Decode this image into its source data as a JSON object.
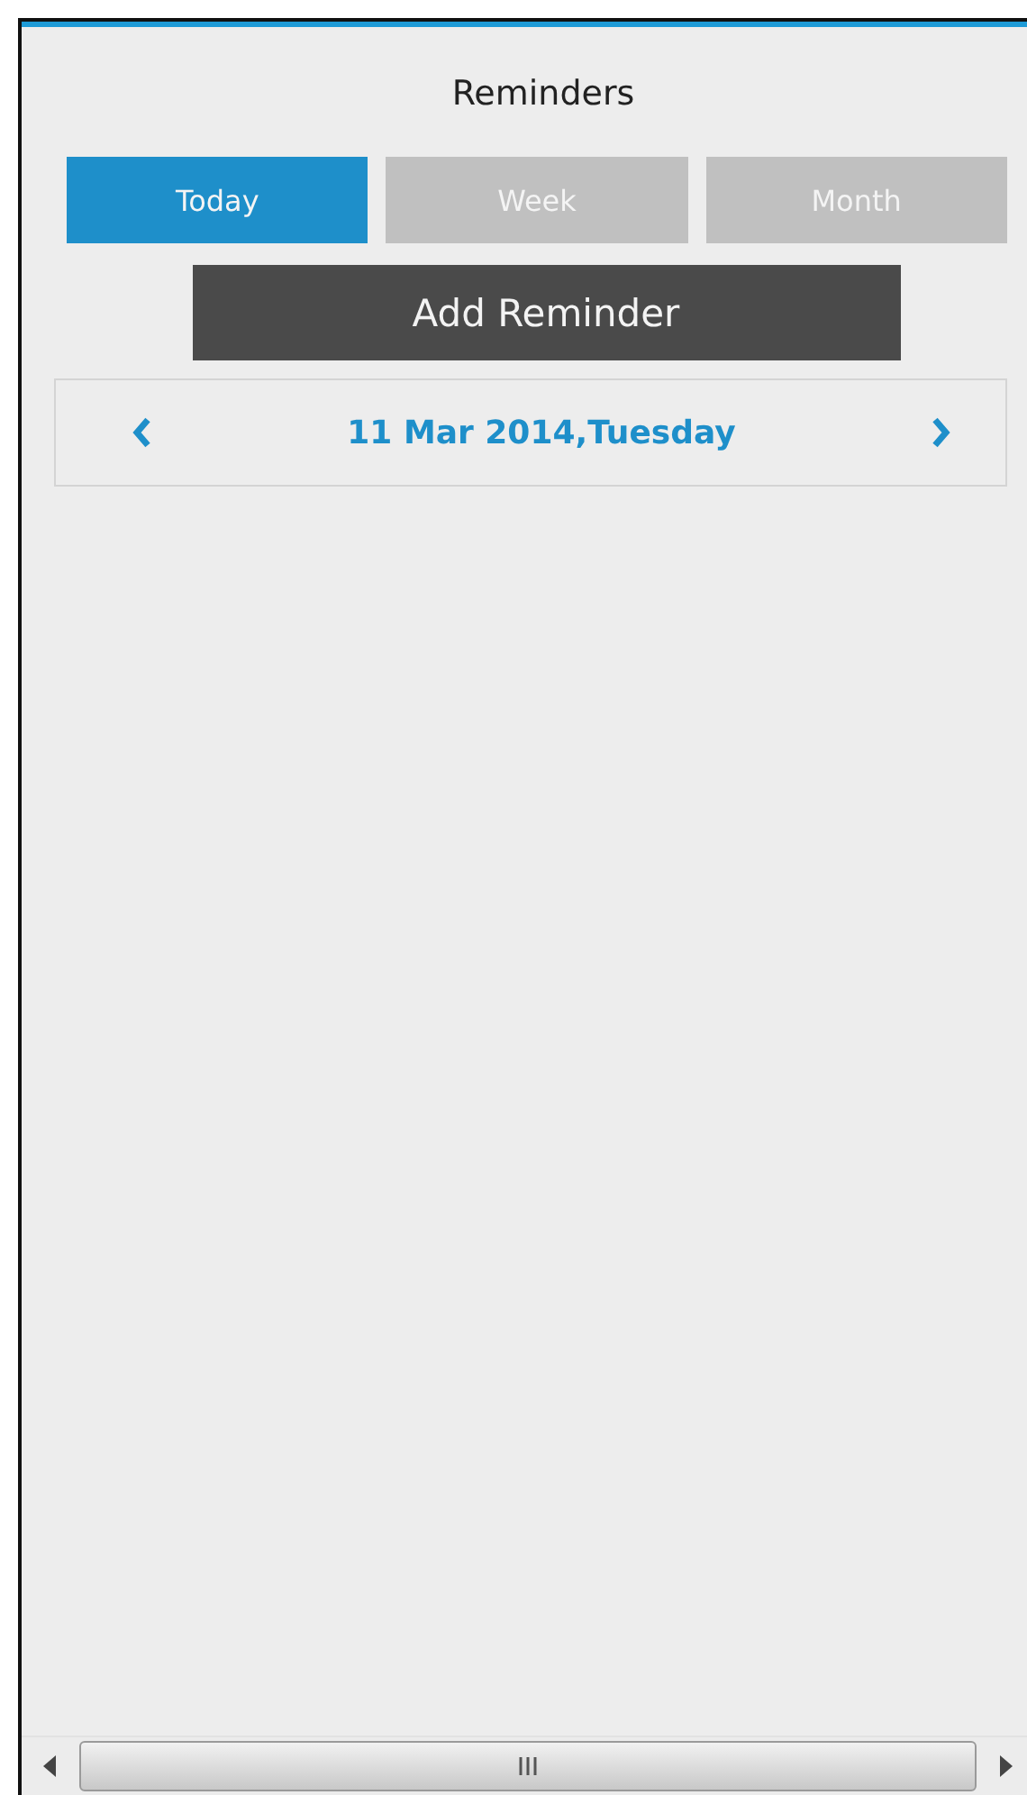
{
  "header": {
    "title": "Reminders"
  },
  "tabs": [
    {
      "label": "Today",
      "selected": true
    },
    {
      "label": "Week",
      "selected": false
    },
    {
      "label": "Month",
      "selected": false
    }
  ],
  "add_button": {
    "label": "Add Reminder"
  },
  "date_nav": {
    "date": "11 Mar 2014,Tuesday"
  }
}
